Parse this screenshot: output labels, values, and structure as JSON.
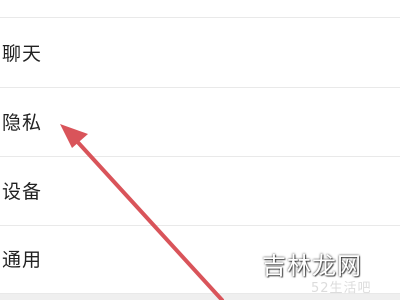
{
  "settings": {
    "items": [
      {
        "label": "聊天"
      },
      {
        "label": "隐私"
      },
      {
        "label": "设备"
      },
      {
        "label": "通用"
      }
    ]
  },
  "annotation": {
    "arrow_color": "#d9545a"
  },
  "watermark": {
    "main": "吉林龙网",
    "sub": "52生活吧"
  },
  "colors": {
    "background": "#ffffff",
    "divider": "#e9e9e9",
    "text": "#222222"
  }
}
